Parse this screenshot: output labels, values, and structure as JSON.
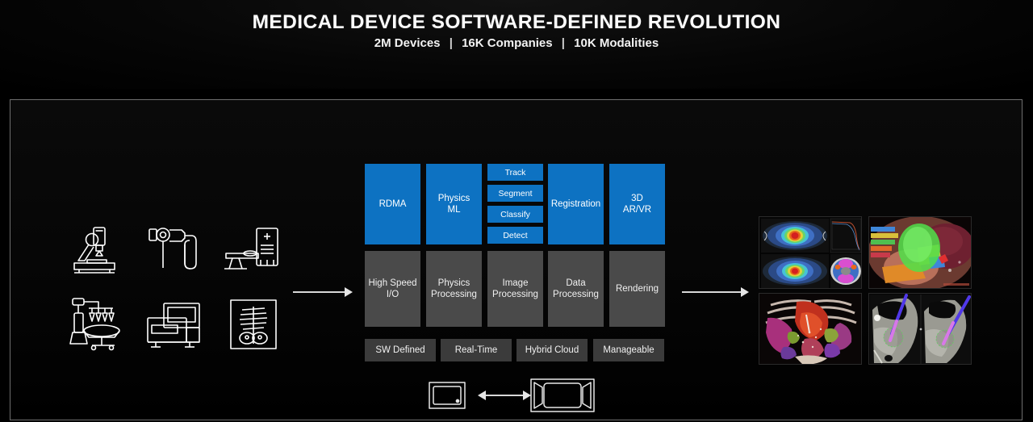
{
  "header": {
    "title": "MEDICAL DEVICE SOFTWARE-DEFINED REVOLUTION",
    "stats": [
      {
        "value": "2M Devices"
      },
      {
        "value": "16K Companies"
      },
      {
        "value": "10K Modalities"
      }
    ],
    "separator": "|"
  },
  "devices": {
    "icons": [
      {
        "name": "microscope-icon",
        "label": "Microscope"
      },
      {
        "name": "endoscope-icon",
        "label": "Endoscope"
      },
      {
        "name": "ct-scanner-icon",
        "label": "CT Scanner"
      },
      {
        "name": "surgical-robot-icon",
        "label": "Surgical Robot"
      },
      {
        "name": "ultrasound-cart-icon",
        "label": "Ultrasound Cart"
      },
      {
        "name": "xray-film-icon",
        "label": "X-Ray"
      }
    ]
  },
  "flow": {
    "arrow_in": "→",
    "arrow_out": "→",
    "arrow_bidirectional": "↔"
  },
  "pipeline": {
    "accelerated": [
      {
        "label": "RDMA"
      },
      {
        "label": "Physics\nML"
      },
      {
        "label": "Registration"
      },
      {
        "label": "3D\nAR/VR"
      }
    ],
    "vision_tasks": [
      {
        "label": "Track"
      },
      {
        "label": "Segment"
      },
      {
        "label": "Classify"
      },
      {
        "label": "Detect"
      }
    ],
    "processing": [
      {
        "label": "High Speed\nI/O"
      },
      {
        "label": "Physics\nProcessing"
      },
      {
        "label": "Image\nProcessing"
      },
      {
        "label": "Data\nProcessing"
      },
      {
        "label": "Rendering"
      }
    ],
    "attributes": [
      {
        "label": "SW Defined"
      },
      {
        "label": "Real-Time"
      },
      {
        "label": "Hybrid Cloud"
      },
      {
        "label": "Manageable"
      }
    ]
  },
  "deployment": {
    "edge": {
      "name": "edge-device-icon",
      "label": "Edge Device"
    },
    "server": {
      "name": "server-rack-icon",
      "label": "Server"
    }
  },
  "outputs": {
    "images": [
      {
        "name": "dose-distribution-image",
        "label": "Radiation Dose Distribution"
      },
      {
        "name": "ar-surgical-overlay-image",
        "label": "AR Surgical Overlay"
      },
      {
        "name": "volume-render-image",
        "label": "3D Volume Render"
      },
      {
        "name": "needle-guidance-image",
        "label": "CT Needle Guidance"
      }
    ]
  },
  "colors": {
    "accent_blue": "#0d72c2",
    "box_gray": "#4a4a4a",
    "pill_gray": "#3b3b3b",
    "frame_border": "#6e6e6e",
    "background": "#000000",
    "text": "#ffffff"
  }
}
